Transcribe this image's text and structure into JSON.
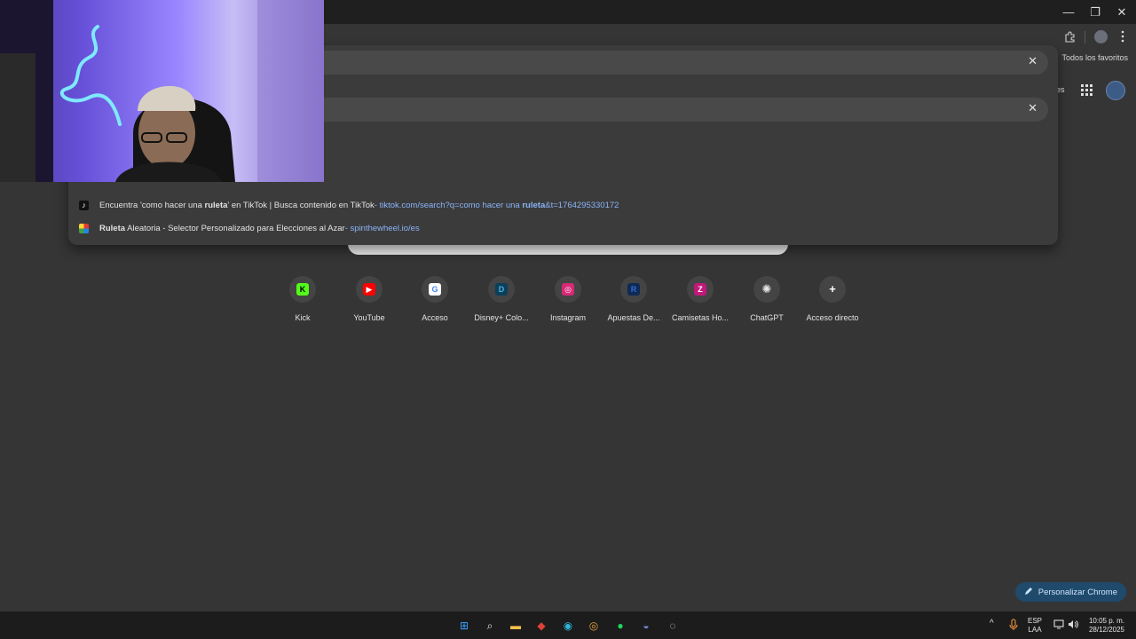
{
  "window": {
    "minimize": "—",
    "restore": "❐",
    "close": "✕"
  },
  "toolbar": {
    "extensions_icon": "puzzle-icon",
    "menu_icon": "kebab-menu-icon"
  },
  "bookmarks": {
    "all_favorites": "Todos los favoritos"
  },
  "header": {
    "partial_link": "es",
    "apps_icon": "grid-icon"
  },
  "omnibox": {
    "clear_symbol": "✕"
  },
  "suggestions": [
    {
      "icon": "tiktok-icon",
      "text_pre": "Encuentra 'como hacer una ",
      "text_bold": "ruleta",
      "text_post": "' en TikTok | Busca contenido en TikTok",
      "separator": " - ",
      "url_pre": "tiktok.com/search?q=como hacer una ",
      "url_bold": "ruleta",
      "url_post": "&t=1764295330172"
    },
    {
      "icon": "spinthewheel-icon",
      "text_bold": "Ruleta",
      "text_post": " Aleatoria - Selector Personalizado para Elecciones al Azar",
      "separator": " - ",
      "url": "spinthewheel.io/es"
    }
  ],
  "shortcuts": [
    {
      "label": "Kick",
      "icon": "kick-icon",
      "glyph": "K",
      "bg": "#53fc18",
      "fg": "#000000"
    },
    {
      "label": "YouTube",
      "icon": "youtube-icon",
      "glyph": "▶",
      "bg": "#ff0000",
      "fg": "#ffffff"
    },
    {
      "label": "Acceso",
      "icon": "google-icon",
      "glyph": "G",
      "bg": "#ffffff",
      "fg": "#4285f4"
    },
    {
      "label": "Disney+ Colo...",
      "icon": "disney-plus-icon",
      "glyph": "D",
      "bg": "#0b3f5b",
      "fg": "#4fb0d8"
    },
    {
      "label": "Instagram",
      "icon": "instagram-icon",
      "glyph": "◎",
      "bg": "#d62976",
      "fg": "#ffffff"
    },
    {
      "label": "Apuestas De...",
      "icon": "betting-site-icon",
      "glyph": "R",
      "bg": "#0e2a55",
      "fg": "#3a6bd0"
    },
    {
      "label": "Camisetas Ho...",
      "icon": "camisetas-icon",
      "glyph": "Z",
      "bg": "#c2187a",
      "fg": "#ffffff"
    },
    {
      "label": "ChatGPT",
      "icon": "chatgpt-icon",
      "glyph": "✺",
      "bg": "#444444",
      "fg": "#e6e6e6"
    },
    {
      "label": "Acceso directo",
      "icon": "plus-icon",
      "glyph": "+",
      "bg": "#444444",
      "fg": "#ffffff"
    }
  ],
  "customize": {
    "label": "Personalizar Chrome"
  },
  "taskbar": {
    "apps": [
      {
        "name": "windows-start-icon",
        "glyph": "⊞",
        "color": "#3aa0ff"
      },
      {
        "name": "search-icon",
        "glyph": "⌕",
        "color": "#e6e6e6"
      },
      {
        "name": "file-explorer-icon",
        "glyph": "▬",
        "color": "#f2c14e"
      },
      {
        "name": "red-app-icon",
        "glyph": "◆",
        "color": "#e0403a"
      },
      {
        "name": "edge-icon",
        "glyph": "◉",
        "color": "#2fb3d9"
      },
      {
        "name": "chrome-icon",
        "glyph": "◎",
        "color": "#e8a33b"
      },
      {
        "name": "spotify-icon",
        "glyph": "●",
        "color": "#1ed760"
      },
      {
        "name": "discord-icon",
        "glyph": "◒",
        "color": "#7289da"
      },
      {
        "name": "obs-icon",
        "glyph": "◌",
        "color": "#dddddd"
      }
    ],
    "tray": {
      "chevron": "^",
      "lang_1": "ESP",
      "lang_2": "LAA",
      "time": "10:05 p. m.",
      "date": "28/12/2025"
    }
  },
  "colors": {
    "background": "#353535",
    "dropdown": "#3b3b3b",
    "link": "#8ab4f8",
    "accent": "#1f4a6b"
  }
}
